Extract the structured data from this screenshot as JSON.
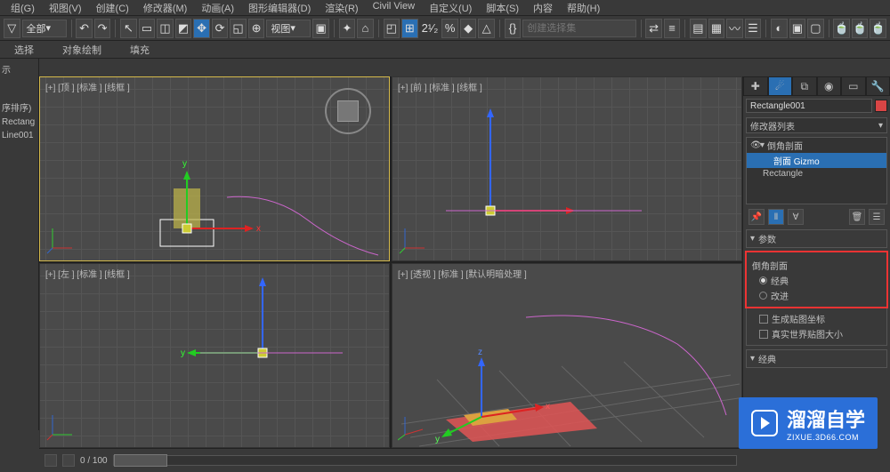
{
  "menu": {
    "items": [
      "组(G)",
      "视图(V)",
      "创建(C)",
      "修改器(M)",
      "动画(A)",
      "图形编辑器(D)",
      "渲染(R)",
      "Civil View",
      "自定义(U)",
      "脚本(S)",
      "内容",
      "帮助(H)"
    ]
  },
  "toolbar": {
    "workspace": "全部",
    "view_dd": "视图",
    "angle_label": "2¹⁄₂",
    "selset_placeholder": "创建选择集"
  },
  "subbar": {
    "items": [
      "选择",
      "对象绘制",
      "填充"
    ]
  },
  "leftpanel": {
    "l1": "示",
    "l2": "",
    "l3": "序排序)",
    "items": [
      "Rectang",
      "Line001"
    ]
  },
  "viewports": {
    "tl": "[+] [顶 ] [标准 ] [线框 ]",
    "tr": "[+] [前 ] [标准 ] [线框 ]",
    "bl": "[+] [左 ] [标准 ] [线框 ]",
    "br": "[+] [透视 ] [标准 ] [默认明暗处理 ]"
  },
  "cmdpanel": {
    "obj_name": "Rectangle001",
    "mod_list_label": "修改器列表",
    "stack": {
      "top": "倒角剖面",
      "sub": "剖面 Gizmo",
      "base": "Rectangle"
    },
    "rollouts": {
      "params": "参数",
      "bevel_section": "倒角剖面",
      "radio_classic": "经典",
      "radio_improved": "改进",
      "chk_gen_map": "生成贴图坐标",
      "chk_real_world": "真实世界贴图大小",
      "classic_section": "经典"
    }
  },
  "timeslider": {
    "label": "0 / 100"
  },
  "watermark": {
    "title": "溜溜自学",
    "sub": "ZIXUE.3D66.COM"
  }
}
